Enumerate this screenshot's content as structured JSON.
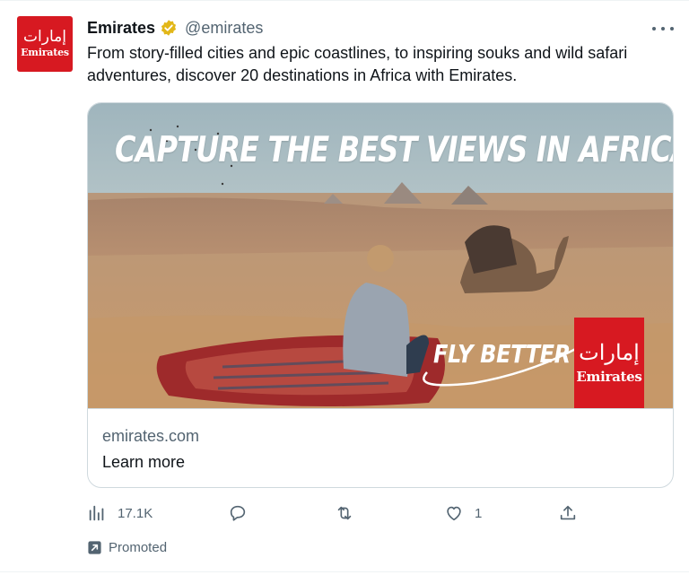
{
  "account": {
    "avatar_glyph": "إمارات",
    "avatar_brand": "Emirates",
    "name": "Emirates",
    "handle": "@emirates",
    "verified_color": "#e2b719"
  },
  "tweet": {
    "text": "From story-filled cities and epic coastlines, to inspiring souks and wild safari adventures, discover 20 destinations in Africa with Emirates."
  },
  "card": {
    "headline": "CAPTURE THE BEST VIEWS IN AFRICA",
    "tagline": "FLY BETTER",
    "logo_glyph": "إمارات",
    "logo_brand": "Emirates",
    "domain": "emirates.com",
    "cta": "Learn more",
    "brand_color": "#d71921"
  },
  "actions": {
    "views_icon": "bar-chart-icon",
    "views": "17.1K",
    "reply_icon": "speech-bubble-icon",
    "retweet_icon": "retweet-icon",
    "like_icon": "heart-icon",
    "likes": "1",
    "share_icon": "share-upload-icon"
  },
  "footer": {
    "promoted_icon": "promoted-arrow-icon",
    "promoted_label": "Promoted"
  }
}
